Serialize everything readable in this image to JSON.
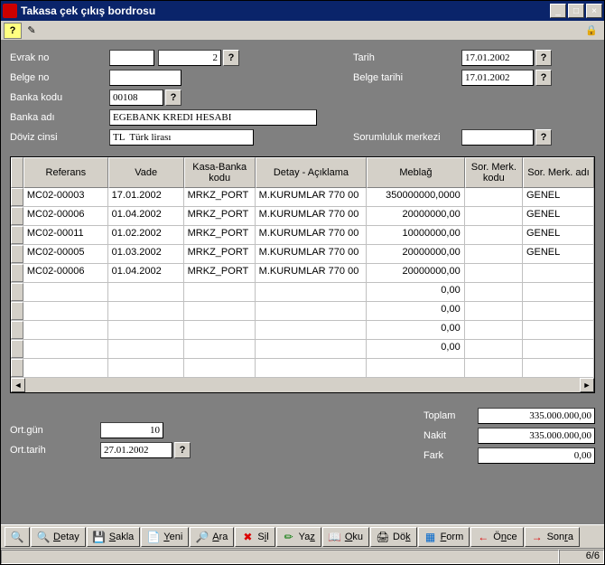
{
  "window": {
    "title": "Takasa çek çıkış bordrosu"
  },
  "win_btns": {
    "min": "_",
    "max": "□",
    "close": "×"
  },
  "form": {
    "labels": {
      "evrak_no": "Evrak no",
      "belge_no": "Belge no",
      "banka_kodu": "Banka kodu",
      "banka_adi": "Banka  adı",
      "doviz_cinsi": "Döviz cinsi",
      "tarih": "Tarih",
      "belge_tarihi": "Belge tarihi",
      "sorumluluk_merkezi": "Sorumluluk merkezi"
    },
    "values": {
      "evrak_no_1": "",
      "evrak_no_2": "2",
      "belge_no": "",
      "banka_kodu": "00108",
      "banka_adi": "EGEBANK KREDI HESABI",
      "doviz_cinsi": "TL  Türk lirası",
      "tarih": "17.01.2002",
      "belge_tarihi": "17.01.2002",
      "sorumluluk_merkezi": ""
    },
    "help": "?"
  },
  "grid": {
    "headers": [
      "Referans",
      "Vade",
      "Kasa-Banka kodu",
      "Detay - Açıklama",
      "Meblağ",
      "Sor. Merk. kodu",
      "Sor. Merk. adı"
    ],
    "rows": [
      {
        "ref": "MC02-00003",
        "vade": "17.01.2002",
        "kasa": "MRKZ_PORT",
        "detay": "M.KURUMLAR 770 00",
        "meblag": "350000000,0000",
        "smk": "",
        "sma": "GENEL"
      },
      {
        "ref": "MC02-00006",
        "vade": "01.04.2002",
        "kasa": "MRKZ_PORT",
        "detay": "M.KURUMLAR 770 00",
        "meblag": "20000000,00",
        "smk": "",
        "sma": "GENEL"
      },
      {
        "ref": "MC02-00011",
        "vade": "01.02.2002",
        "kasa": "MRKZ_PORT",
        "detay": "M.KURUMLAR 770 00",
        "meblag": "10000000,00",
        "smk": "",
        "sma": "GENEL"
      },
      {
        "ref": "MC02-00005",
        "vade": "01.03.2002",
        "kasa": "MRKZ_PORT",
        "detay": "M.KURUMLAR 770 00",
        "meblag": "20000000,00",
        "smk": "",
        "sma": "GENEL"
      },
      {
        "ref": "MC02-00006",
        "vade": "01.04.2002",
        "kasa": "MRKZ_PORT",
        "detay": "M.KURUMLAR 770 00",
        "meblag": "20000000,00",
        "smk": "",
        "sma": ""
      },
      {
        "ref": "",
        "vade": "",
        "kasa": "",
        "detay": "",
        "meblag": "0,00",
        "smk": "",
        "sma": ""
      },
      {
        "ref": "",
        "vade": "",
        "kasa": "",
        "detay": "",
        "meblag": "0,00",
        "smk": "",
        "sma": ""
      },
      {
        "ref": "",
        "vade": "",
        "kasa": "",
        "detay": "",
        "meblag": "0,00",
        "smk": "",
        "sma": ""
      },
      {
        "ref": "",
        "vade": "",
        "kasa": "",
        "detay": "",
        "meblag": "0,00",
        "smk": "",
        "sma": ""
      },
      {
        "ref": "",
        "vade": "",
        "kasa": "",
        "detay": "",
        "meblag": "",
        "smk": "",
        "sma": ""
      }
    ]
  },
  "totals": {
    "labels": {
      "ort_gun": "Ort.gün",
      "ort_tarih": "Ort.tarih",
      "toplam": "Toplam",
      "nakit": "Nakit",
      "fark": "Fark"
    },
    "values": {
      "ort_gun": "10",
      "ort_tarih": "27.01.2002",
      "toplam": "335.000.000,00",
      "nakit": "335.000.000,00",
      "fark": "0,00"
    }
  },
  "toolbar": {
    "detay": "Detay",
    "sakla": "Sakla",
    "yeni": "Yeni",
    "ara": "Ara",
    "sil": "Sil",
    "yaz": "Yaz",
    "oku": "Oku",
    "dok": "Dök",
    "form": "Form",
    "once": "Önce",
    "sonra": "Sonra"
  },
  "shortcut_letters": {
    "detay": "D",
    "sakla": "S",
    "yeni": "Y",
    "ara": "A",
    "sil": "i",
    "yaz": "z",
    "oku": "O",
    "dok": "k",
    "form": "F",
    "once": "n",
    "sonra": "r"
  },
  "statusbar": {
    "record": "6/6"
  },
  "scroll": {
    "left": "◄",
    "right": "►"
  },
  "icons": {
    "help": "?",
    "audit": "✎",
    "lock": "🔒",
    "detay": "🔍",
    "sakla": "💾",
    "yeni": "📄",
    "ara": "🔎",
    "sil": "✖",
    "yaz": "✏",
    "oku": "📖",
    "dok": "🖨",
    "form": "▦",
    "once": "←",
    "sonra": "→"
  }
}
